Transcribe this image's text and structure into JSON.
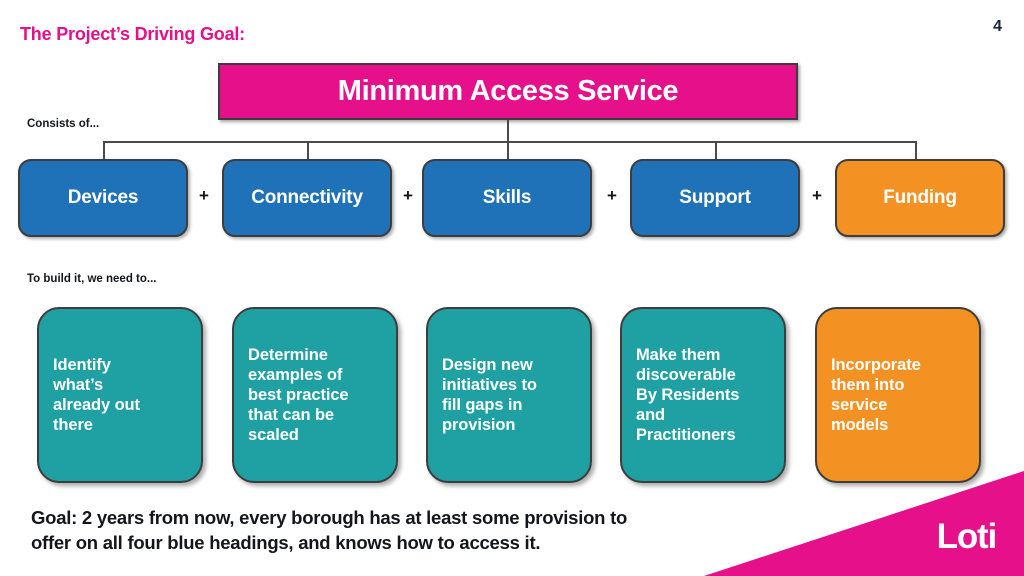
{
  "slide": {
    "title": "The Project’s Driving Goal:",
    "page_number": "4",
    "background_color": "#ffffff"
  },
  "master": {
    "label": "Minimum Access Service",
    "color": "#e5108a",
    "text_color": "#ffffff"
  },
  "captions": {
    "consists_of": "Consists of...",
    "to_build": "To build it, we need to..."
  },
  "components": {
    "separator": "+",
    "items": [
      {
        "label": "Devices",
        "color": "#2072b8"
      },
      {
        "label": "Connectivity",
        "color": "#2072b8"
      },
      {
        "label": "Skills",
        "color": "#2072b8"
      },
      {
        "label": "Support",
        "color": "#2072b8"
      },
      {
        "label": "Funding",
        "color": "#f39222"
      }
    ]
  },
  "actions": {
    "items": [
      {
        "label": "Identify\nwhat’s\nalready out\nthere",
        "color": "#1fa0a3"
      },
      {
        "label": "Determine\nexamples of\nbest practice\nthat can be\nscaled",
        "color": "#1fa0a3"
      },
      {
        "label": "Design new\ninitiatives to\nfill gaps in\nprovision",
        "color": "#1fa0a3"
      },
      {
        "label": "Make them\ndiscoverable\nBy Residents\nand\nPractitioners",
        "color": "#1fa0a3"
      },
      {
        "label": "Incorporate\nthem into\nservice\nmodels",
        "color": "#f39222"
      }
    ]
  },
  "footer": {
    "goal_text": "Goal: 2 years from now, every borough has at least some provision to\noffer on all four blue headings, and knows how to access it.",
    "logo_text": "Loti",
    "wedge_color": "#e5108a"
  }
}
